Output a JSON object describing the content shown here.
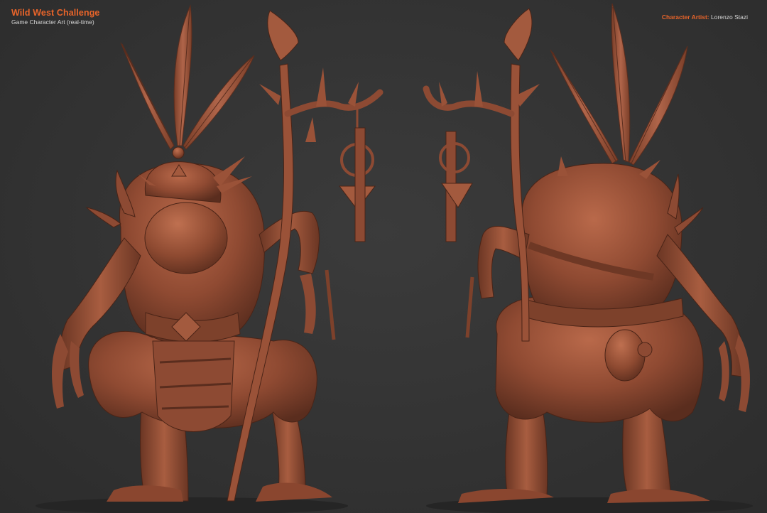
{
  "header": {
    "title": "Wild West Challenge",
    "subtitle": "Game Character Art (real-time)",
    "credit_label": "Character Artist:",
    "credit_name": "Lorenzo Stazi"
  },
  "colors": {
    "background": "#343434",
    "accent": "#e8642a",
    "clay": "#9a5238",
    "clay_light": "#b9694a",
    "clay_dark": "#5e2f1f"
  },
  "renders": [
    {
      "view": "front",
      "subject": "creature sculpt with staff and feathers"
    },
    {
      "view": "back",
      "subject": "creature sculpt with staff and feathers"
    }
  ]
}
